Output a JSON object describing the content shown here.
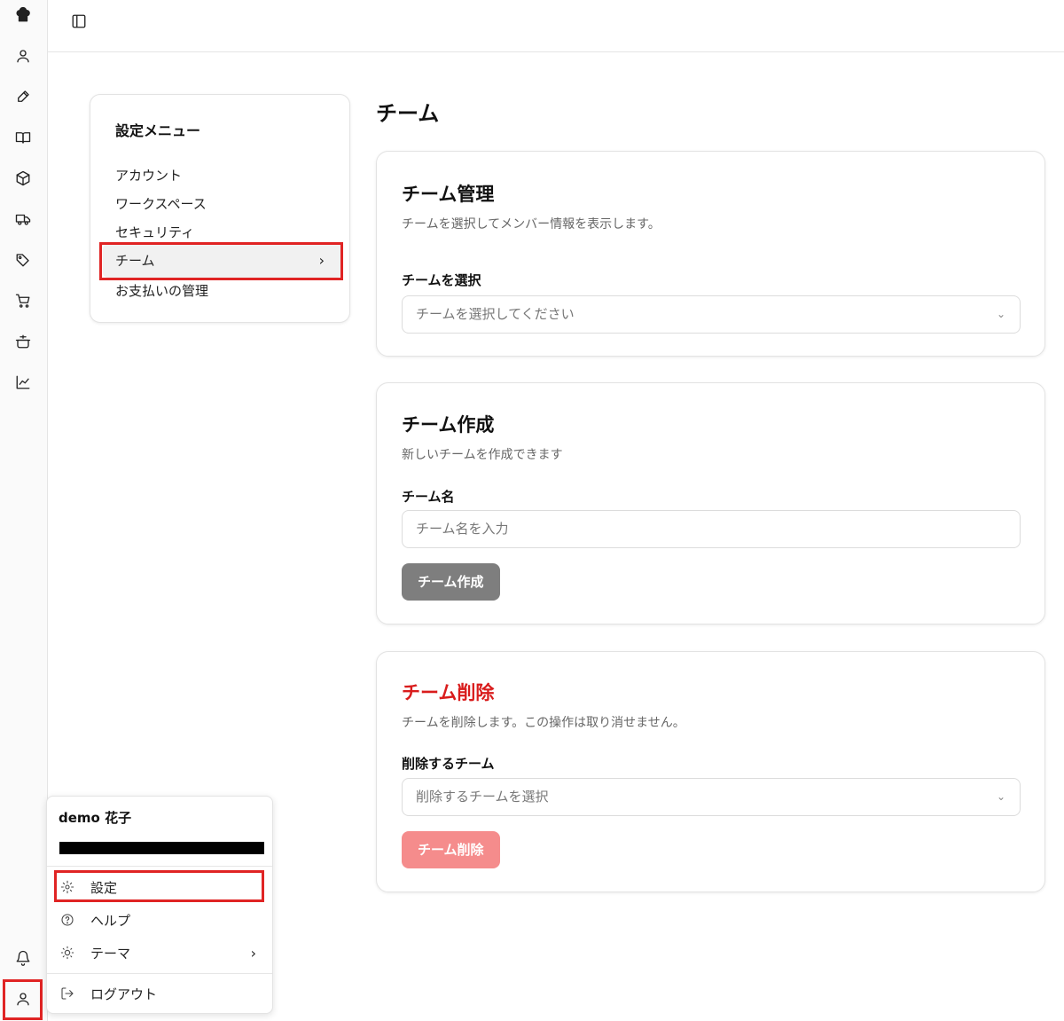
{
  "rail": {
    "icons": [
      "chef-hat-icon",
      "user-icon",
      "pen-icon",
      "book-icon",
      "package-icon",
      "truck-icon",
      "tags-icon",
      "cart-icon",
      "pot-icon",
      "chart-icon"
    ],
    "bottom": [
      "bell-icon",
      "user-icon"
    ]
  },
  "settings_menu": {
    "title": "設定メニュー",
    "items": [
      "アカウント",
      "ワークスペース",
      "セキュリティ",
      "チーム",
      "お支払いの管理"
    ],
    "active_chevron": "›"
  },
  "page": {
    "title": "チーム"
  },
  "team_manage": {
    "title": "チーム管理",
    "desc": "チームを選択してメンバー情報を表示します。",
    "label": "チームを選択",
    "placeholder": "チームを選択してください"
  },
  "team_create": {
    "title": "チーム作成",
    "desc": "新しいチームを作成できます",
    "label": "チーム名",
    "placeholder": "チーム名を入力",
    "button": "チーム作成"
  },
  "team_delete": {
    "title": "チーム削除",
    "desc": "チームを削除します。この操作は取り消せません。",
    "label": "削除するチーム",
    "placeholder": "削除するチームを選択",
    "button": "チーム削除"
  },
  "user_popup": {
    "name": "demo 花子",
    "items": {
      "settings": "設定",
      "help": "ヘルプ",
      "theme": "テーマ",
      "logout": "ログアウト"
    }
  },
  "colors": {
    "danger": "#d91c1c",
    "highlight": "#e02424"
  }
}
